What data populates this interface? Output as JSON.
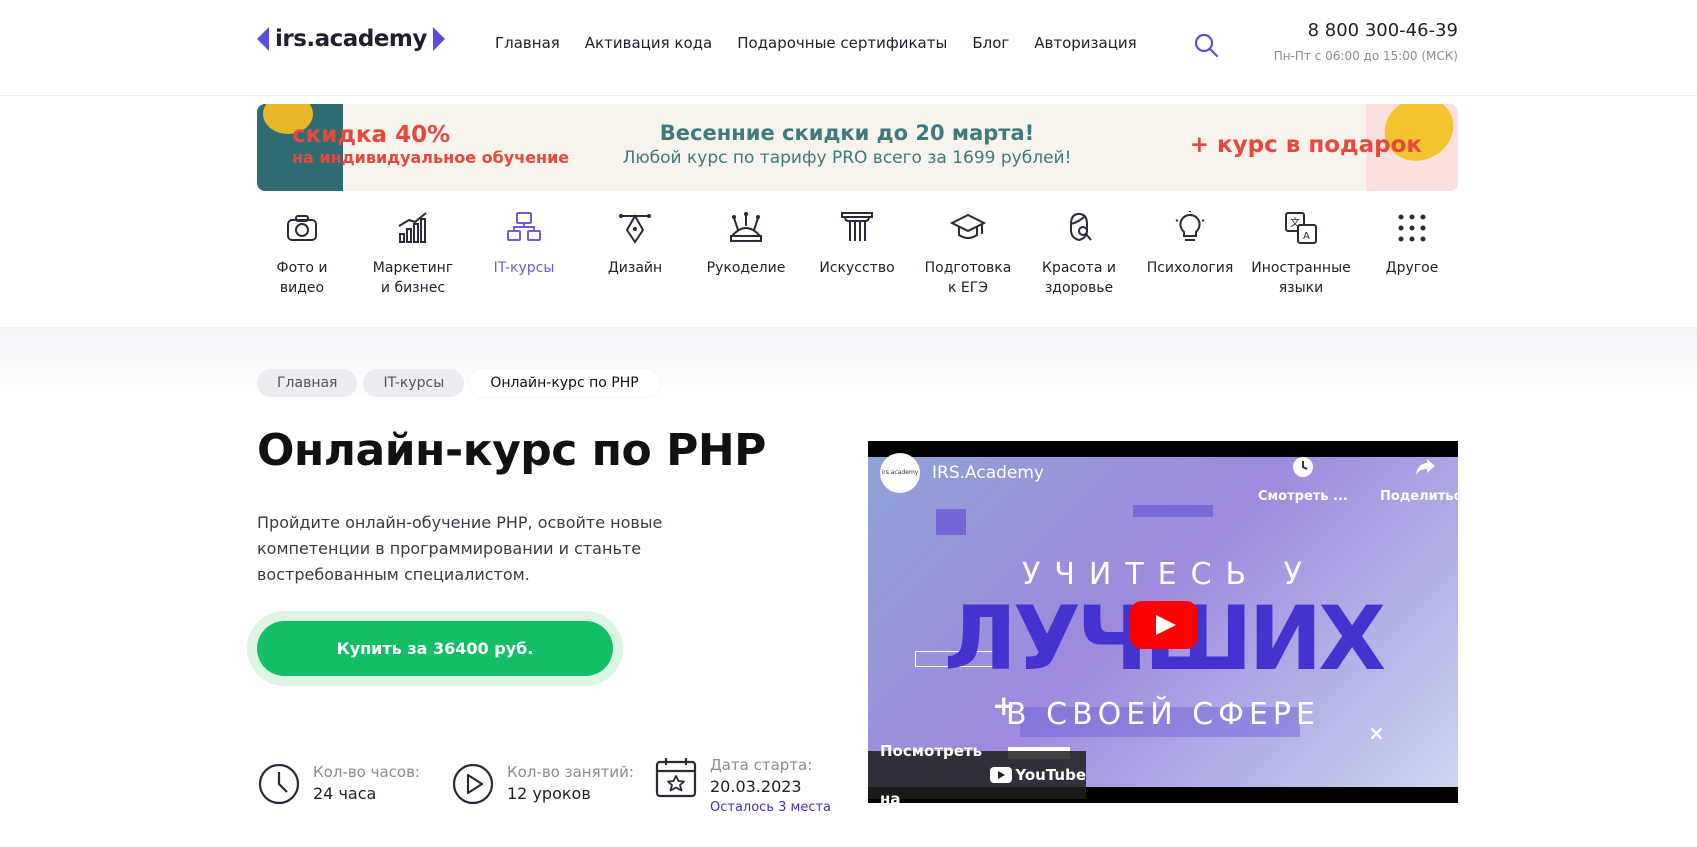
{
  "header": {
    "logo": "irs.academy",
    "nav": [
      "Главная",
      "Активация кода",
      "Подарочные сертификаты",
      "Блог",
      "Авторизация"
    ],
    "phone": "8 800 300-46-39",
    "hours": "Пн-Пт с 06:00 до 15:00 (МСК)"
  },
  "banner": {
    "discount_big": "скидка 40%",
    "discount_small": "на индивидуальное обучение",
    "title": "Весенние скидки до 20 марта!",
    "subtitle": "Любой курс по тарифу PRO всего за 1699 рублей!",
    "gift": "+ курс в подарок"
  },
  "categories": [
    {
      "line1": "Фото и",
      "line2": "видео"
    },
    {
      "line1": "Маркетинг",
      "line2": "и бизнес"
    },
    {
      "line1": "IT-курсы",
      "line2": ""
    },
    {
      "line1": "Дизайн",
      "line2": ""
    },
    {
      "line1": "Рукоделие",
      "line2": ""
    },
    {
      "line1": "Искусство",
      "line2": ""
    },
    {
      "line1": "Подготовка",
      "line2": "к ЕГЭ"
    },
    {
      "line1": "Красота и",
      "line2": "здоровье"
    },
    {
      "line1": "Психология",
      "line2": ""
    },
    {
      "line1": "Иностранные",
      "line2": "языки"
    },
    {
      "line1": "Другое",
      "line2": ""
    }
  ],
  "breadcrumbs": [
    "Главная",
    "IT-курсы",
    "Онлайн-курс по PHP"
  ],
  "course": {
    "title": "Онлайн-курс по PHP",
    "description": "Пройдите онлайн-обучение PHP, освойте новые компетенции в программировании и станьте востребованным специалистом.",
    "buy_label": "Купить за 36400 руб."
  },
  "stats": {
    "hours_label": "Кол-во часов:",
    "hours_value": "24 часа",
    "lessons_label": "Кол-во занятий:",
    "lessons_value": "12 уроков",
    "start_label": "Дата старта:",
    "start_value": "20.03.2023",
    "seats_left": "Осталось 3 места"
  },
  "video": {
    "avatar_text": "irs.academy",
    "channel": "IRS.Academy",
    "watch_later": "Смотреть ...",
    "share": "Поделиться",
    "line1": "УЧИТЕСЬ У",
    "line2": "ЛУЧШИХ",
    "line3": "В СВОЕЙ СФЕРЕ",
    "watch_on": "Посмотреть на",
    "youtube": "YouTube"
  },
  "colors": {
    "accent": "#5b4fd8",
    "buy_green": "#13bf66",
    "promo_red": "#e8483b",
    "promo_teal": "#3f7a7e"
  }
}
